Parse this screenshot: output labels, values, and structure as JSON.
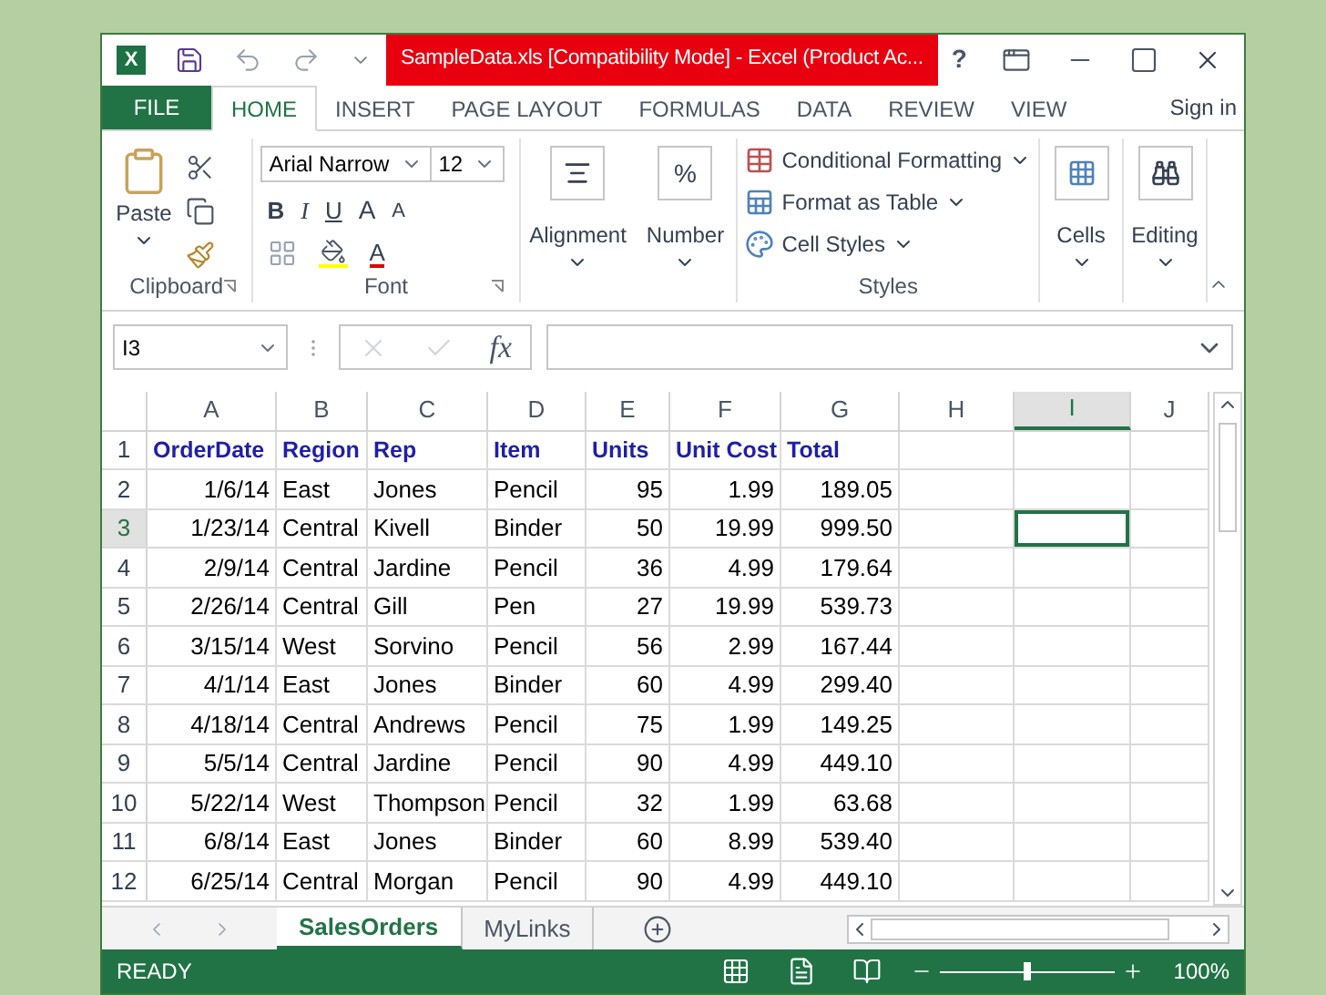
{
  "title_bar": {
    "logo": "X",
    "title": "SampleData.xls  [Compatibility Mode] -  Excel (Product Ac...",
    "help": "?"
  },
  "ribbon_tabs": [
    {
      "label": "FILE",
      "kind": "file",
      "selected": false
    },
    {
      "label": "HOME",
      "kind": "tab",
      "selected": true
    },
    {
      "label": "INSERT",
      "kind": "tab",
      "selected": false
    },
    {
      "label": "PAGE LAYOUT",
      "kind": "tab",
      "selected": false
    },
    {
      "label": "FORMULAS",
      "kind": "tab",
      "selected": false
    },
    {
      "label": "DATA",
      "kind": "tab",
      "selected": false
    },
    {
      "label": "REVIEW",
      "kind": "tab",
      "selected": false
    },
    {
      "label": "VIEW",
      "kind": "tab",
      "selected": false
    }
  ],
  "sign_in": "Sign in",
  "ribbon": {
    "clipboard": {
      "paste": "Paste",
      "group": "Clipboard"
    },
    "font": {
      "name": "Arial Narrow",
      "size": "12",
      "bold": "B",
      "italic": "I",
      "underline": "U",
      "grow": "A",
      "shrink": "A",
      "color_letter": "A",
      "group": "Font"
    },
    "alignment": "Alignment",
    "number": "Number",
    "number_symbol": "%",
    "styles": {
      "items": [
        "Conditional Formatting",
        "Format as Table",
        "Cell Styles"
      ],
      "group": "Styles"
    },
    "cells": "Cells",
    "editing": "Editing"
  },
  "formula_bar": {
    "name_box": "I3",
    "fx": "fx"
  },
  "grid": {
    "columns": [
      {
        "label": "A",
        "selected": false
      },
      {
        "label": "B",
        "selected": false
      },
      {
        "label": "C",
        "selected": false
      },
      {
        "label": "D",
        "selected": false
      },
      {
        "label": "E",
        "selected": false
      },
      {
        "label": "F",
        "selected": false
      },
      {
        "label": "G",
        "selected": false
      },
      {
        "label": "H",
        "selected": false
      },
      {
        "label": "I",
        "selected": true
      },
      {
        "label": "J",
        "selected": false
      }
    ],
    "rows": [
      {
        "label": "1",
        "kind": "header",
        "selected": false,
        "cells": [
          "OrderDate",
          "Region",
          "Rep",
          "Item",
          "Units",
          "Unit Cost",
          "Total"
        ]
      },
      {
        "label": "2",
        "kind": "data",
        "selected": false,
        "cells": [
          "1/6/14",
          "East",
          "Jones",
          "Pencil",
          "95",
          "1.99",
          "189.05"
        ]
      },
      {
        "label": "3",
        "kind": "data",
        "selected": true,
        "cells": [
          "1/23/14",
          "Central",
          "Kivell",
          "Binder",
          "50",
          "19.99",
          "999.50"
        ]
      },
      {
        "label": "4",
        "kind": "data",
        "selected": false,
        "cells": [
          "2/9/14",
          "Central",
          "Jardine",
          "Pencil",
          "36",
          "4.99",
          "179.64"
        ]
      },
      {
        "label": "5",
        "kind": "data",
        "selected": false,
        "cells": [
          "2/26/14",
          "Central",
          "Gill",
          "Pen",
          "27",
          "19.99",
          "539.73"
        ]
      },
      {
        "label": "6",
        "kind": "data",
        "selected": false,
        "cells": [
          "3/15/14",
          "West",
          "Sorvino",
          "Pencil",
          "56",
          "2.99",
          "167.44"
        ]
      },
      {
        "label": "7",
        "kind": "data",
        "selected": false,
        "cells": [
          "4/1/14",
          "East",
          "Jones",
          "Binder",
          "60",
          "4.99",
          "299.40"
        ]
      },
      {
        "label": "8",
        "kind": "data",
        "selected": false,
        "cells": [
          "4/18/14",
          "Central",
          "Andrews",
          "Pencil",
          "75",
          "1.99",
          "149.25"
        ]
      },
      {
        "label": "9",
        "kind": "data",
        "selected": false,
        "cells": [
          "5/5/14",
          "Central",
          "Jardine",
          "Pencil",
          "90",
          "4.99",
          "449.10"
        ]
      },
      {
        "label": "10",
        "kind": "data",
        "selected": false,
        "cells": [
          "5/22/14",
          "West",
          "Thompson",
          "Pencil",
          "32",
          "1.99",
          "63.68"
        ]
      },
      {
        "label": "11",
        "kind": "data",
        "selected": false,
        "cells": [
          "6/8/14",
          "East",
          "Jones",
          "Binder",
          "60",
          "8.99",
          "539.40"
        ]
      },
      {
        "label": "12",
        "kind": "data",
        "selected": false,
        "cells": [
          "6/25/14",
          "Central",
          "Morgan",
          "Pencil",
          "90",
          "4.99",
          "449.10"
        ]
      }
    ]
  },
  "sheet_tabs": [
    {
      "label": "SalesOrders",
      "selected": true
    },
    {
      "label": "MyLinks",
      "selected": false
    }
  ],
  "status_bar": {
    "status": "READY",
    "zoom": {
      "level": 0.5,
      "reading": "100%"
    }
  }
}
